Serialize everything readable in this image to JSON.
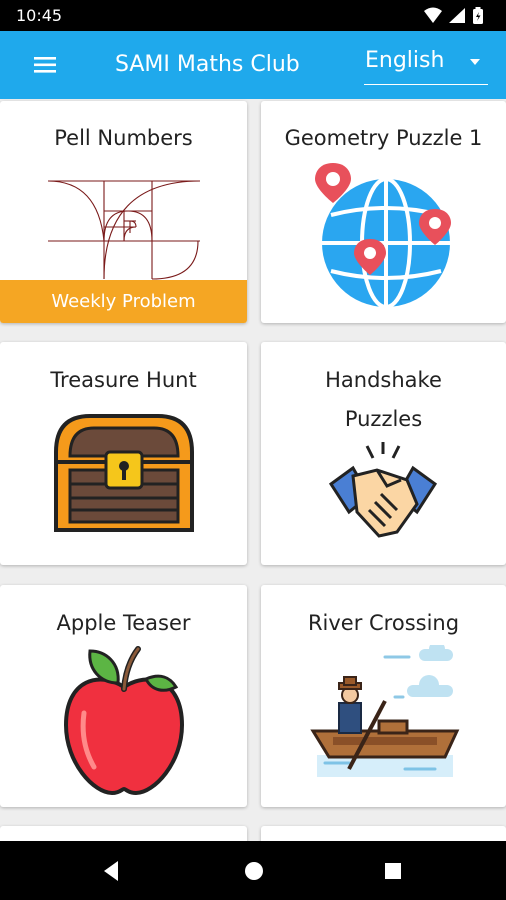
{
  "status_bar": {
    "time": "10:45",
    "icons": [
      "wifi-icon",
      "signal-icon",
      "battery-icon"
    ]
  },
  "app_bar": {
    "title": "SAMI Maths Club",
    "menu_icon": "hamburger-menu-icon",
    "language": "English",
    "accent_color": "#1fa9ec"
  },
  "cards": [
    {
      "title": "Pell Numbers",
      "icon": "golden-spiral-icon",
      "banner": "Weekly Problem"
    },
    {
      "title": "Geometry Puzzle 1",
      "icon": "globe-pins-icon"
    },
    {
      "title": "Treasure Hunt",
      "icon": "treasure-chest-icon"
    },
    {
      "title": "Handshake",
      "title_line2": "Puzzles",
      "icon": "handshake-icon"
    },
    {
      "title": "Apple Teaser",
      "icon": "apple-icon"
    },
    {
      "title": "River Crossing",
      "icon": "boat-icon"
    }
  ],
  "colors": {
    "banner": "#f5a623",
    "card_bg": "#ffffff",
    "page_bg": "#eeeeee"
  },
  "nav_bar": {
    "icons": [
      "back-icon",
      "home-icon",
      "recents-icon"
    ]
  }
}
